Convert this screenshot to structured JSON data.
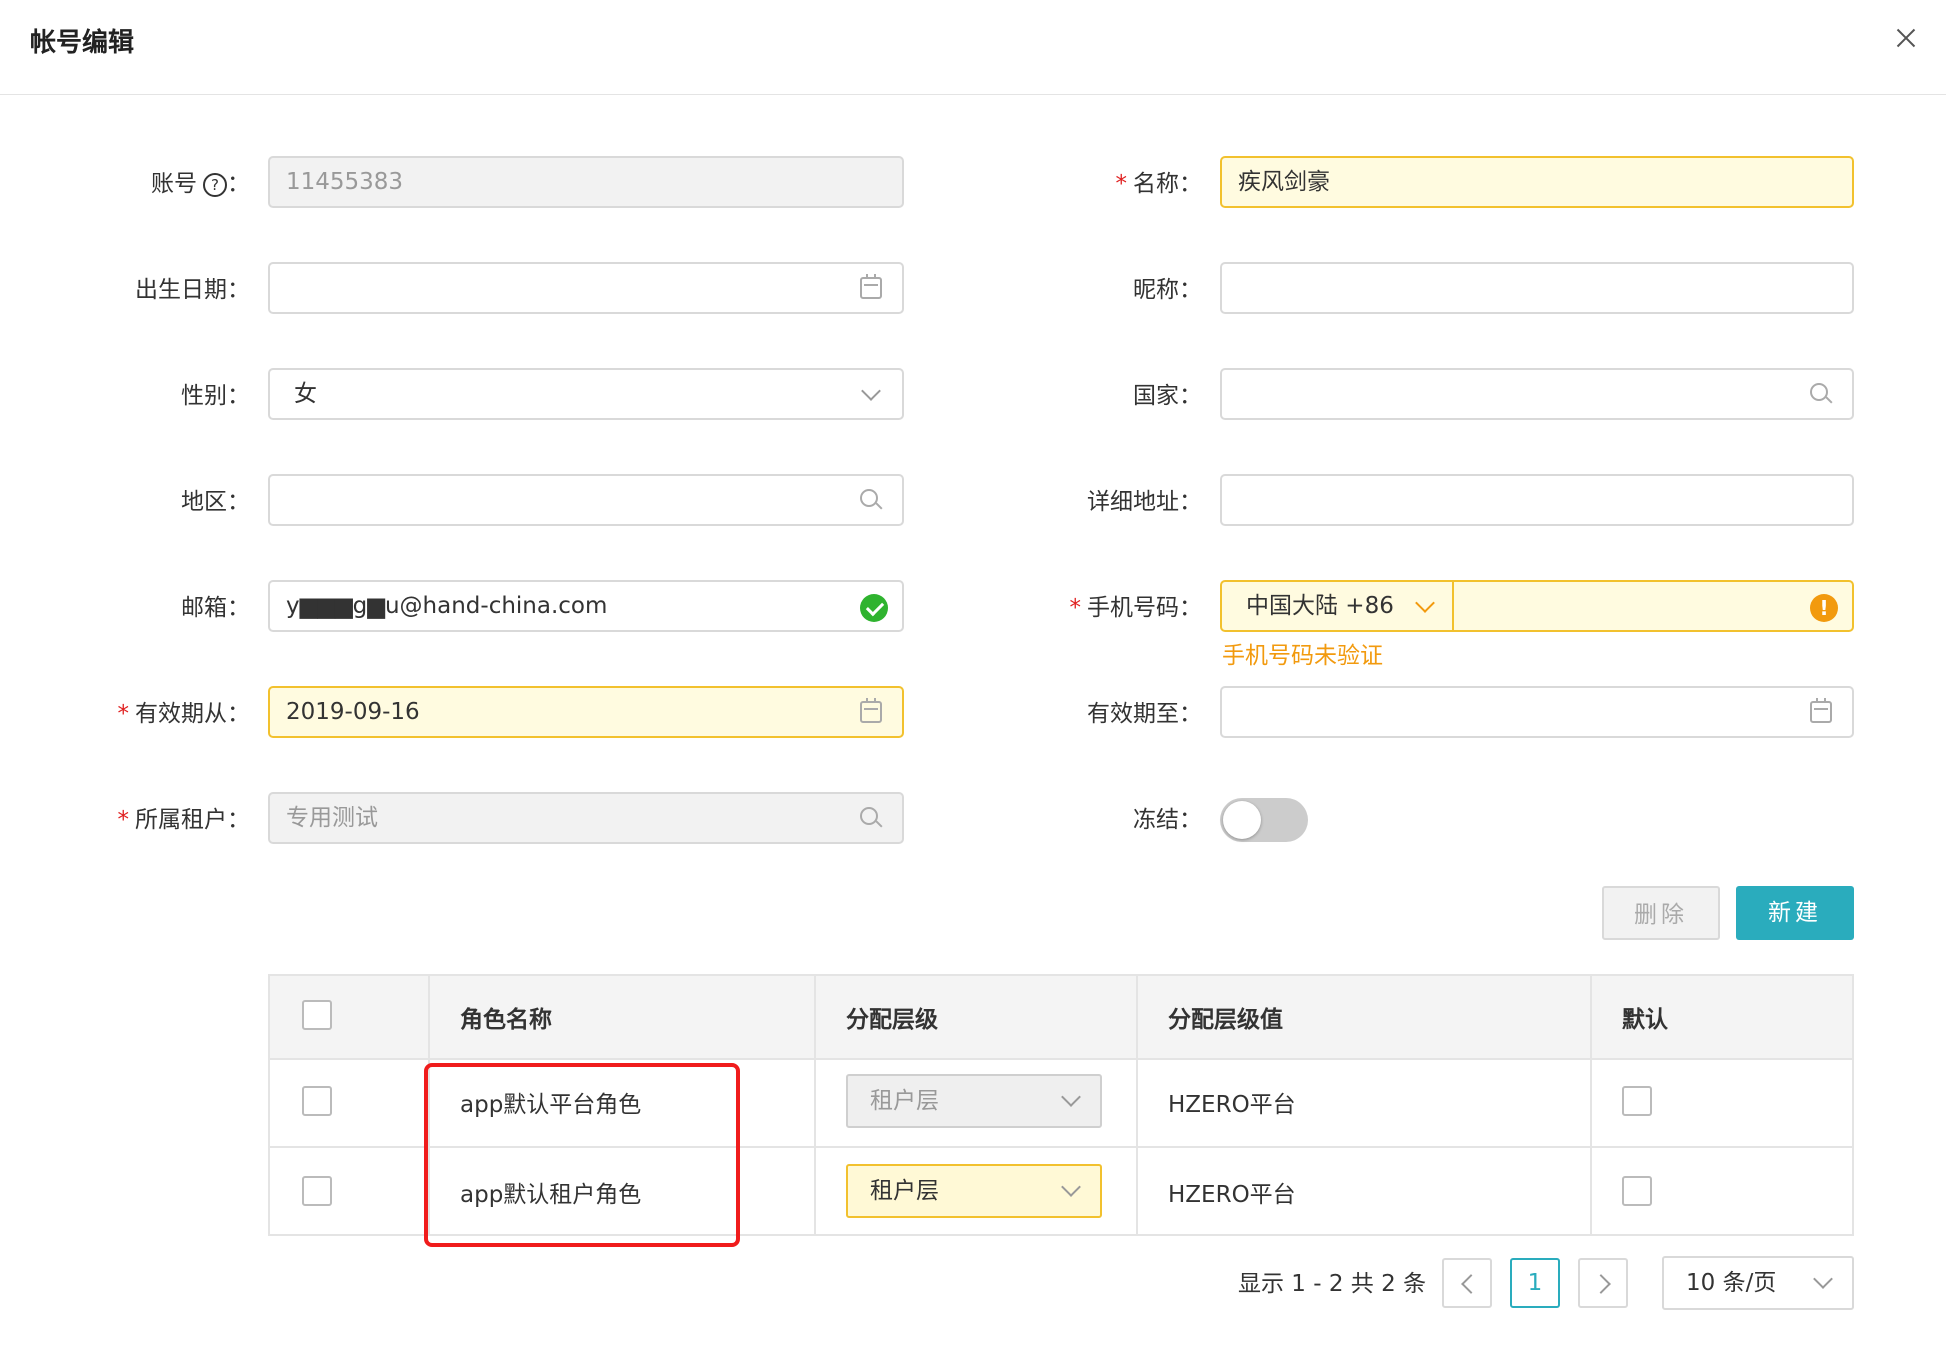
{
  "dialog": {
    "title": "帐号编辑"
  },
  "form": {
    "account": {
      "label": "账号",
      "help": "?",
      "value": "11455383"
    },
    "name": {
      "label": "名称",
      "value": "疾风剑豪"
    },
    "birthday": {
      "label": "出生日期",
      "value": ""
    },
    "nickname": {
      "label": "昵称",
      "value": ""
    },
    "gender": {
      "label": "性别",
      "value": "女"
    },
    "country": {
      "label": "国家",
      "value": ""
    },
    "region": {
      "label": "地区",
      "value": ""
    },
    "address": {
      "label": "详细地址",
      "value": ""
    },
    "email": {
      "label": "邮箱",
      "value": "y▆▆▆g▆u@hand-china.com"
    },
    "phone": {
      "label": "手机号码",
      "prefix": "中国大陆 +86",
      "value": "",
      "warning": "手机号码未验证"
    },
    "valid_from": {
      "label": "有效期从",
      "value": "2019-09-16"
    },
    "valid_to": {
      "label": "有效期至",
      "value": ""
    },
    "tenant": {
      "label": "所属租户",
      "value": "专用测试"
    },
    "frozen": {
      "label": "冻结",
      "on": false
    },
    "colon": "：",
    "required_mark": "*"
  },
  "toolbar": {
    "delete_label": "删除",
    "new_label": "新建"
  },
  "table": {
    "columns": [
      "角色名称",
      "分配层级",
      "分配层级值",
      "默认"
    ],
    "rows": [
      {
        "role": "app默认平台角色",
        "level": "租户层",
        "level_value": "HZERO平台",
        "level_disabled": true
      },
      {
        "role": "app默认租户角色",
        "level": "租户层",
        "level_value": "HZERO平台",
        "level_disabled": false
      }
    ]
  },
  "pagination": {
    "info": "显示 1 - 2 共 2 条",
    "current_page": "1",
    "page_size": "10 条/页"
  },
  "colors": {
    "primary": "#2aacbd",
    "warning": "#f29a0e",
    "success": "#2fb32f",
    "highlight": "#f01c1c",
    "required_bg": "#fffbe0"
  }
}
